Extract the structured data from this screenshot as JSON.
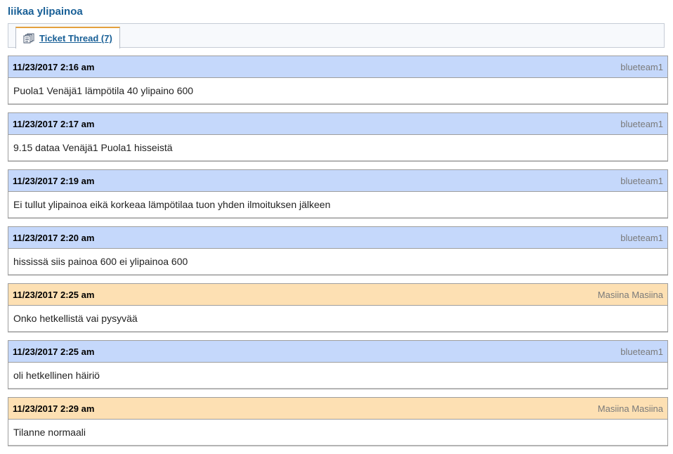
{
  "ticket": {
    "title": "liikaa ylipainoa"
  },
  "tabs": [
    {
      "label": "Ticket Thread (7)",
      "icon": "thread-icon"
    }
  ],
  "colors": {
    "staff_header": "#c5d8fb",
    "user_header": "#fde0b3",
    "title": "#185f96",
    "tab_accent": "#e3a03e"
  },
  "thread": [
    {
      "time": "11/23/2017 2:16 am",
      "author": "blueteam1",
      "type": "staff",
      "body": "Puola1 Venäjä1 lämpötila 40 ylipaino 600"
    },
    {
      "time": "11/23/2017 2:17 am",
      "author": "blueteam1",
      "type": "staff",
      "body": "9.15 dataa Venäjä1 Puola1 hisseistä"
    },
    {
      "time": "11/23/2017 2:19 am",
      "author": "blueteam1",
      "type": "staff",
      "body": "Ei tullut ylipainoa eikä korkeaa lämpötilaa tuon yhden ilmoituksen jälkeen"
    },
    {
      "time": "11/23/2017 2:20 am",
      "author": "blueteam1",
      "type": "staff",
      "body": "hississä siis painoa 600 ei ylipainoa 600"
    },
    {
      "time": "11/23/2017 2:25 am",
      "author": "Masiina Masiina",
      "type": "user",
      "body": "Onko hetkellistä vai pysyvää"
    },
    {
      "time": "11/23/2017 2:25 am",
      "author": "blueteam1",
      "type": "staff",
      "body": "oli hetkellinen häiriö"
    },
    {
      "time": "11/23/2017 2:29 am",
      "author": "Masiina Masiina",
      "type": "user",
      "body": "Tilanne normaali"
    }
  ]
}
